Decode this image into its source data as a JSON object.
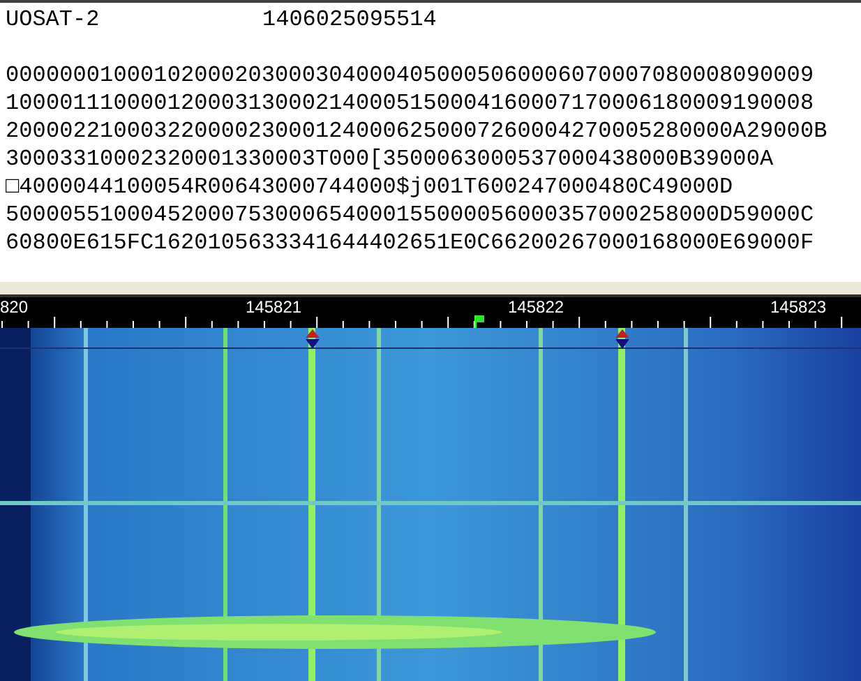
{
  "header": {
    "satellite": "UOSAT-2",
    "timestamp": "1406025095514"
  },
  "telemetry_lines": [
    "000000010001020002030003040004050005060006070007080008090009",
    "100001110000120003130002140005150004160007170006180009190008",
    "200002210003220000230001240006250007260004270005280000A29000B",
    "30003310002320001330003T000[3500063000537000438000B39000A",
    "□4000044100054R00643000744000$j001T600247000480C49000D",
    "50000551000452000753000654000155000056000357000258000D59000C",
    "60800E615FC1620105633341644402651E0C66200267000168000E69000F"
  ],
  "frequency_scale": {
    "labels": [
      "820",
      "145821",
      "145822",
      "145823"
    ]
  }
}
